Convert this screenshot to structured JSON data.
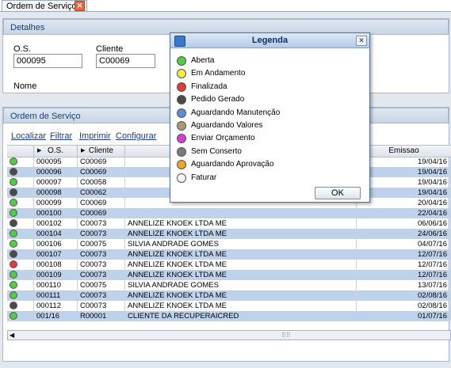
{
  "tab": {
    "title": "Ordem de Serviço"
  },
  "details": {
    "header": "Detalhes",
    "os_label": "O.S.",
    "os_value": "000095",
    "client_label": "Cliente",
    "client_value": "C00069",
    "name_label": "Nome"
  },
  "grid": {
    "header": "Ordem de Serviço",
    "toolbar": [
      "Localizar",
      "Filtrar",
      "Imprimir",
      "Configurar"
    ],
    "columns": [
      "O.S.",
      "Cliente",
      "",
      "Emissao"
    ],
    "rows": [
      {
        "status": "green",
        "os": "000095",
        "client": "C00069",
        "name": "",
        "date": "19/04/16"
      },
      {
        "status": "dark",
        "os": "000096",
        "client": "C00069",
        "name": "",
        "date": "19/04/16"
      },
      {
        "status": "green",
        "os": "000097",
        "client": "C00058",
        "name": "",
        "date": "19/04/16"
      },
      {
        "status": "dark",
        "os": "000098",
        "client": "C00062",
        "name": "",
        "date": "19/04/16"
      },
      {
        "status": "green",
        "os": "000099",
        "client": "C00069",
        "name": "",
        "date": "20/04/16"
      },
      {
        "status": "green",
        "os": "000100",
        "client": "C00069",
        "name": "",
        "date": "22/04/16"
      },
      {
        "status": "dark",
        "os": "000102",
        "client": "C00073",
        "name": "ANNELIZE KNOEK LTDA ME",
        "date": "06/06/16"
      },
      {
        "status": "green",
        "os": "000104",
        "client": "C00073",
        "name": "ANNELIZE KNOEK LTDA ME",
        "date": "24/06/16"
      },
      {
        "status": "green",
        "os": "000106",
        "client": "C00075",
        "name": "SILVIA ANDRADE GOMES",
        "date": "04/07/16"
      },
      {
        "status": "dark",
        "os": "000107",
        "client": "C00073",
        "name": "ANNELIZE KNOEK LTDA ME",
        "date": "12/07/16"
      },
      {
        "status": "red",
        "os": "000108",
        "client": "C00073",
        "name": "ANNELIZE KNOEK LTDA ME",
        "date": "12/07/16"
      },
      {
        "status": "green",
        "os": "000109",
        "client": "C00073",
        "name": "ANNELIZE KNOEK LTDA ME",
        "date": "12/07/16"
      },
      {
        "status": "green",
        "os": "000110",
        "client": "C00075",
        "name": "SILVIA ANDRADE GOMES",
        "date": "13/07/16"
      },
      {
        "status": "green",
        "os": "000111",
        "client": "C00073",
        "name": "ANNELIZE KNOEK LTDA ME",
        "date": "02/08/16"
      },
      {
        "status": "dark",
        "os": "000112",
        "client": "C00073",
        "name": "ANNELIZE KNOEK LTDA ME",
        "date": "02/08/16"
      },
      {
        "status": "green",
        "os": "001/16",
        "client": "R00001",
        "name": "CLIENTE DA RECUPERAICRED",
        "date": "01/07/16"
      }
    ]
  },
  "legend": {
    "title": "Legenda",
    "items": [
      {
        "label": "Aberta",
        "color": "#4fcf3f"
      },
      {
        "label": "Em Andamento",
        "color": "#f2ee3a"
      },
      {
        "label": "Finalizada",
        "color": "#e23b3b"
      },
      {
        "label": "Pedido Gerado",
        "color": "#4a4a4a"
      },
      {
        "label": "Aguardando Manutenção",
        "color": "#5a8fd6"
      },
      {
        "label": "Aguardando Valores",
        "color": "#a8977a"
      },
      {
        "label": "Enviar Orçamento",
        "color": "#d63cd6"
      },
      {
        "label": "Sem Conserto",
        "color": "#7a7a7a"
      },
      {
        "label": "Aguardando Aprovação",
        "color": "#f0a22a"
      },
      {
        "label": "Faturar",
        "color": "#f4f4f4"
      }
    ],
    "ok_label": "OK"
  },
  "status_colors": {
    "green": "#4fcf3f",
    "dark": "#4a4a4a",
    "red": "#e23b3b"
  }
}
